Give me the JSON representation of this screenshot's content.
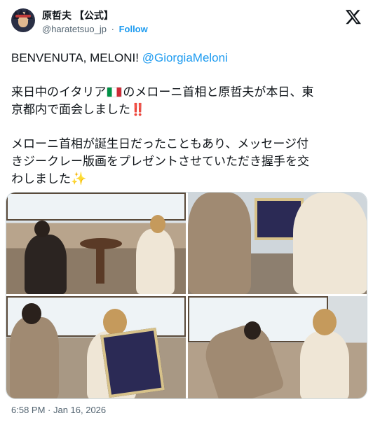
{
  "author": {
    "display_name": "原哲夫 【公式】",
    "handle": "@haratetsuo_jp",
    "separator": "·",
    "follow_label": "Follow",
    "avatar_icon": "avatar-illustration"
  },
  "tweet": {
    "line1_text": "BENVENUTA, MELONI! ",
    "line1_mention": "@GiorgiaMeloni",
    "para2_line1_a": "来日中のイタリア",
    "para2_flag": "italy-flag-icon",
    "para2_line1_b": "のメローニ首相と原哲夫が本日、東",
    "para2_line2": "京都内で面会しました",
    "para2_emoji": "‼️",
    "para3_line1": "メローニ首相が誕生日だったこともあり、メッセージ付",
    "para3_line2": "きジークレー版画をプレゼントさせていただき握手を交",
    "para3_line3": "わしました",
    "para3_emoji": "✨"
  },
  "media": {
    "count": 4
  },
  "timestamp": "6:58 PM · Jan 16, 2026",
  "colors": {
    "link": "#1d9bf0",
    "text": "#0f1419",
    "secondary": "#536471"
  }
}
